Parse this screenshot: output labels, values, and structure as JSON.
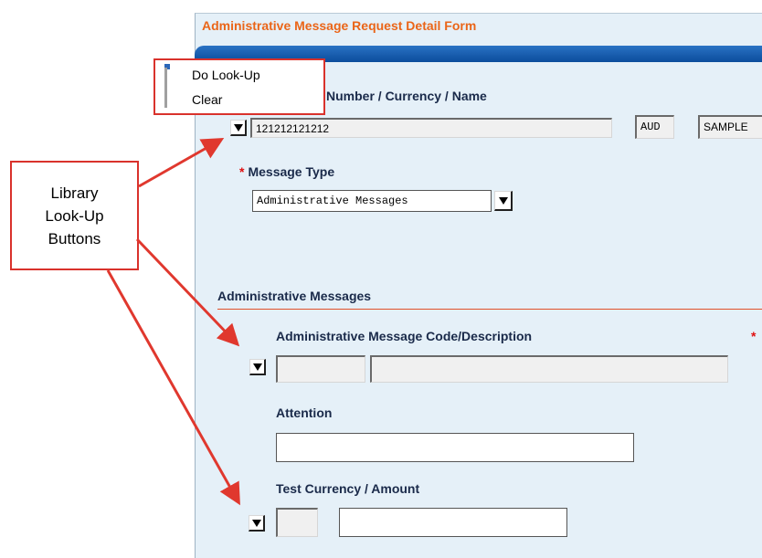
{
  "form": {
    "title": "Administrative Message Request Detail Form",
    "account_label": "Number / Currency / Name",
    "account_number": "121212121212",
    "currency": "AUD",
    "name": "SAMPLE",
    "message_type_label": "Message Type",
    "message_type_value": "Administrative Messages",
    "section_title": "Administrative Messages",
    "code_desc_label": "Administrative Message Code/Description",
    "code_value": "",
    "description_value": "",
    "attention_label": "Attention",
    "attention_value": "",
    "test_label": "Test Currency / Amount",
    "test_currency_value": "",
    "test_amount_value": "",
    "required_marker": "*"
  },
  "context_menu": {
    "items": [
      "Do Look-Up",
      "Clear"
    ]
  },
  "callout": {
    "lines": [
      "Library",
      "Look-Up",
      "Buttons"
    ]
  },
  "colors": {
    "form_bg": "#e5f0f8",
    "title_orange": "#ea6518",
    "header_blue": "#0b4d9c",
    "callout_red": "#d9322c"
  }
}
